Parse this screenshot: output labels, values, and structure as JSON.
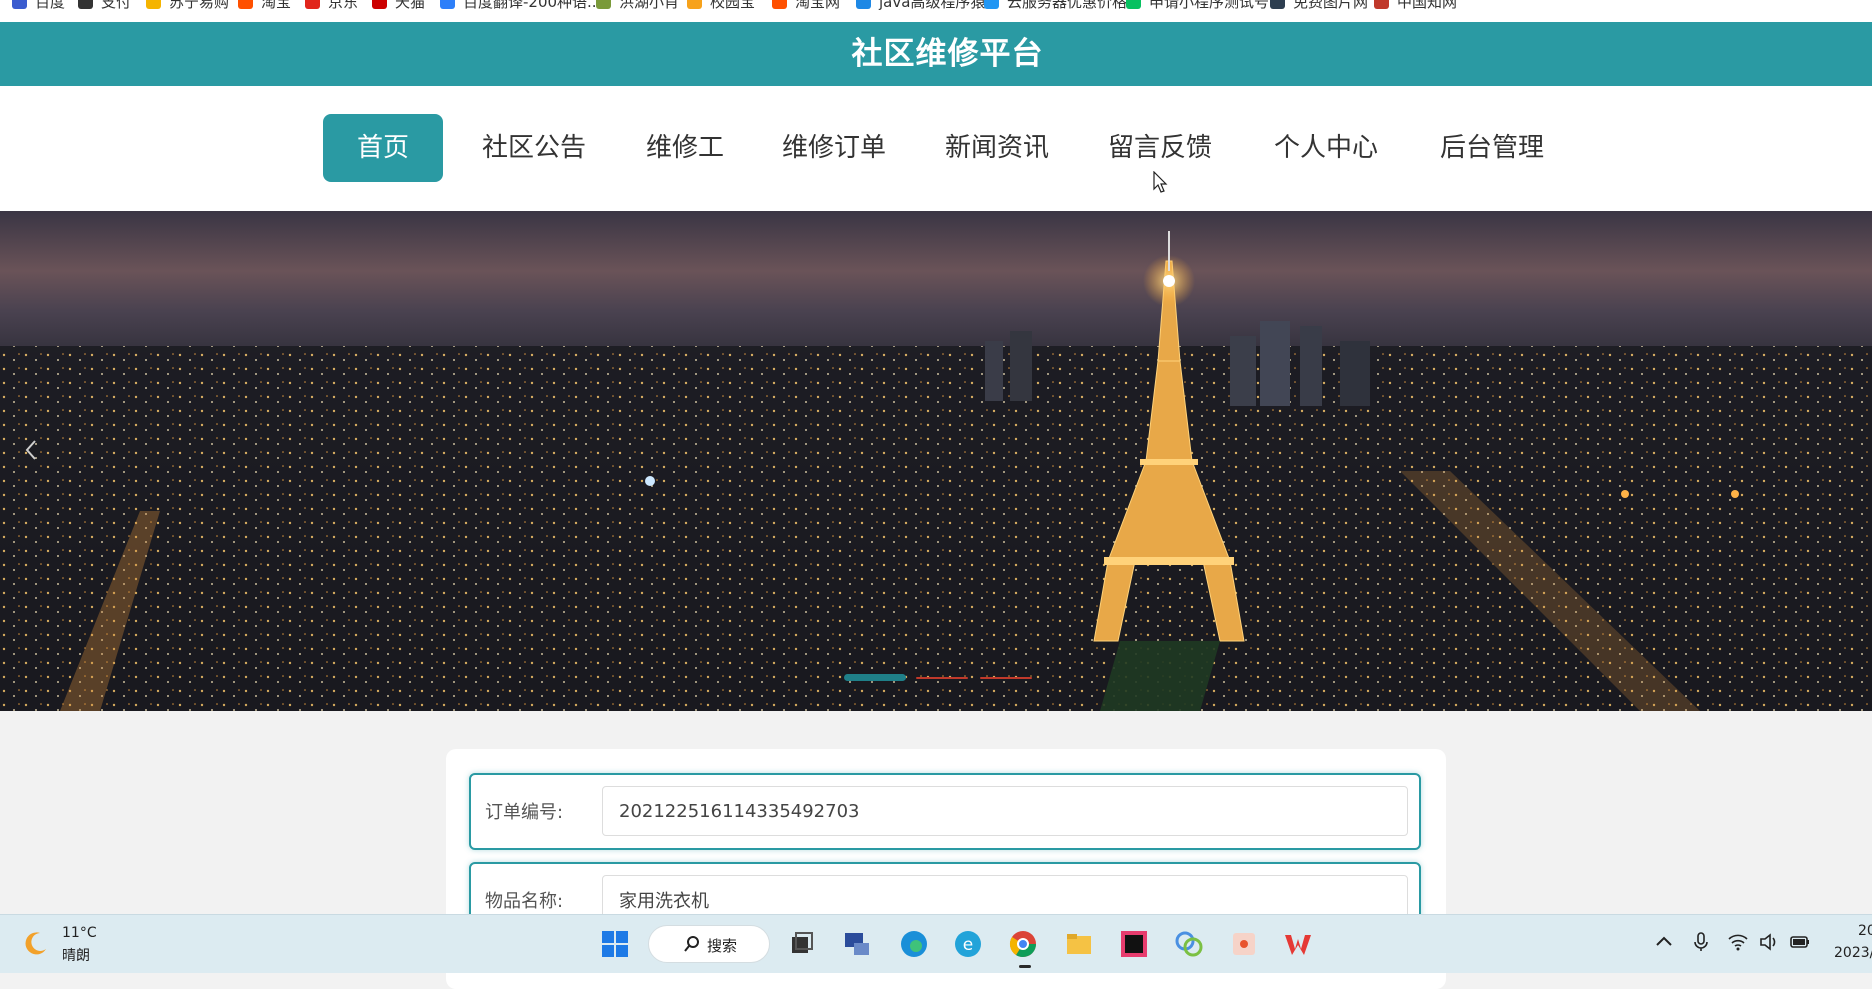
{
  "bookmarks": [
    {
      "label": "百度",
      "color": "#3b5ccf"
    },
    {
      "label": "支付",
      "color": "#333333"
    },
    {
      "label": "苏宁易购",
      "color": "#f5b400"
    },
    {
      "label": "淘宝",
      "color": "#ff5000"
    },
    {
      "label": "京东",
      "color": "#e1251b"
    },
    {
      "label": "天猫",
      "color": "#cc0000"
    },
    {
      "label": "百度翻译-200种语...",
      "color": "#2d7ff9"
    },
    {
      "label": "洪湖小肖",
      "color": "#7a9a3a"
    },
    {
      "label": "校园宝",
      "color": "#f7a21b"
    },
    {
      "label": "淘宝网",
      "color": "#ff5000"
    },
    {
      "label": "java高级程序猿",
      "color": "#1e88e5"
    },
    {
      "label": "云服务器优惠价格",
      "color": "#2196f3"
    },
    {
      "label": "申请小程序测试号",
      "color": "#07c160"
    },
    {
      "label": "免费图片网",
      "color": "#2d3e50"
    },
    {
      "label": "中国知网",
      "color": "#c0392b"
    }
  ],
  "header": {
    "title": "社区维修平台",
    "bg_color": "#2a9aa3"
  },
  "nav": {
    "items": [
      {
        "label": "首页",
        "active": true
      },
      {
        "label": "社区公告",
        "active": false
      },
      {
        "label": "维修工",
        "active": false
      },
      {
        "label": "维修订单",
        "active": false
      },
      {
        "label": "新闻资讯",
        "active": false
      },
      {
        "label": "留言反馈",
        "active": false
      },
      {
        "label": "个人中心",
        "active": false
      },
      {
        "label": "后台管理",
        "active": false
      }
    ]
  },
  "carousel": {
    "prev_icon": "chevron-left-icon",
    "slides": 3,
    "active_index": 0,
    "active_color": "#1f7f88",
    "inactive_color": "#c0392b"
  },
  "form": {
    "order_no": {
      "label": "订单编号:",
      "value": "202122516114335492703"
    },
    "item_name": {
      "label": "物品名称:",
      "value": "家用洗衣机"
    }
  },
  "taskbar": {
    "weather": {
      "temp": "11°C",
      "desc": "晴朗",
      "icon": "moon-icon"
    },
    "search_label": "搜索",
    "clock": {
      "time": "20",
      "date": "2023/"
    }
  }
}
